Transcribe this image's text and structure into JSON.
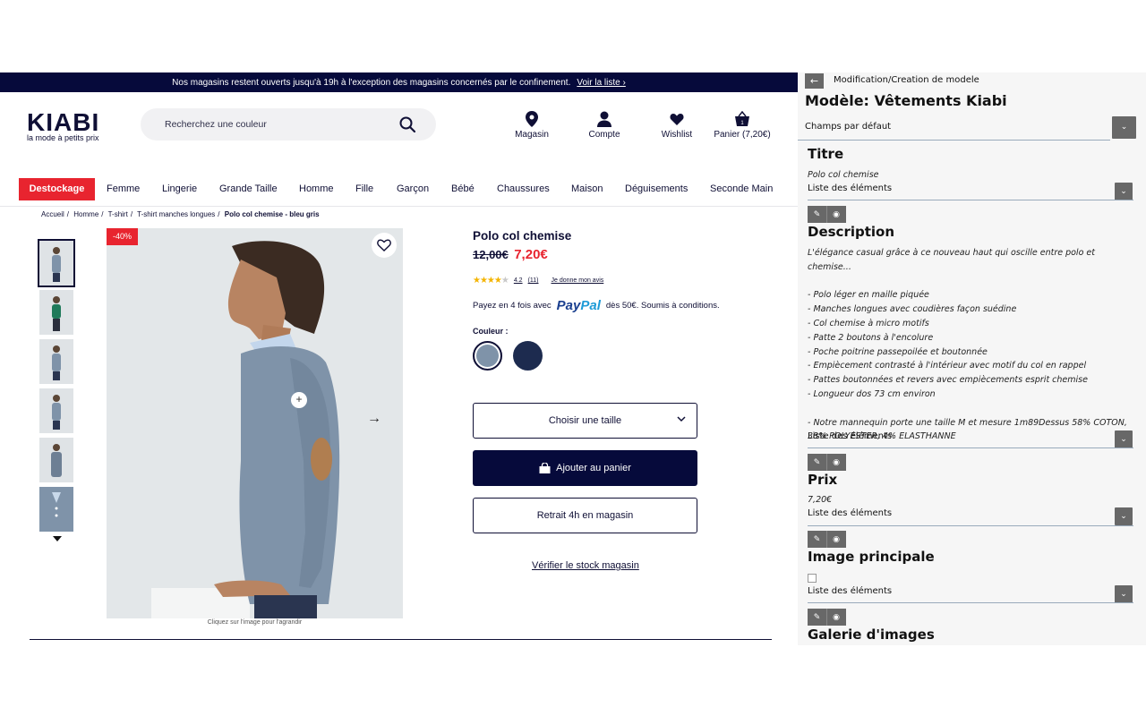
{
  "shop": {
    "promo_text": "Nos magasins restent ouverts jusqu'à 19h à l'exception des magasins concernés par le confinement.",
    "promo_link": "Voir la liste ›",
    "brand": "KIABI",
    "tagline": "la mode à petits prix",
    "search_placeholder": "Recherchez une couleur",
    "header": {
      "magasin": "Magasin",
      "compte": "Compte",
      "wishlist": "Wishlist",
      "panier": "Panier (7,20€)",
      "cart_count": "1"
    },
    "nav": [
      "Destockage",
      "Femme",
      "Lingerie",
      "Grande Taille",
      "Homme",
      "Fille",
      "Garçon",
      "Bébé",
      "Chaussures",
      "Maison",
      "Déguisements",
      "Seconde Main"
    ],
    "breadcrumb": [
      "Accueil",
      "Homme",
      "T-shirt",
      "T-shirt manches longues",
      "Polo col chemise - bleu gris"
    ],
    "discount_badge": "-40%",
    "image_caption": "Cliquez sur l'image pour l'agrandir",
    "product": {
      "title": "Polo col chemise",
      "old_price": "12,00€",
      "new_price": "7,20€",
      "rating": "4.2",
      "rating_value": 4.2,
      "reviews": "(11)",
      "review_link": "Je donne mon avis",
      "paypal_prefix": "Payez en 4 fois avec",
      "paypal_suffix": "dès 50€. Soumis à conditions.",
      "color_label": "Couleur :",
      "size_button": "Choisir une taille",
      "cart_button": "Ajouter au panier",
      "store_button": "Retrait 4h en magasin",
      "stock_link": "Vérifier le stock magasin"
    }
  },
  "panel": {
    "breadcrumb": "Modification/Creation de modele",
    "model_title": "Modèle: Vêtements Kiabi",
    "default_fields": "Champs par défaut",
    "list_label": "Liste des éléments",
    "sections": {
      "titre": {
        "title": "Titre",
        "value": "Polo col chemise"
      },
      "description": {
        "title": "Description",
        "lines": [
          "L'élégance casual grâce à ce nouveau haut qui oscille entre polo et chemise...",
          "",
          "- Polo léger en maille piquée",
          "- Manches longues avec coudières façon suédine",
          "- Col chemise à micro motifs",
          "- Patte 2 boutons à l'encolure",
          "- Poche poitrine passepoilée et boutonnée",
          "- Empiècement contrasté à l'intérieur avec motif du col en rappel",
          "- Pattes boutonnées et revers avec empiècements esprit chemise",
          "- Longueur dos 73 cm environ",
          "",
          "- Notre mannequin porte une taille M et mesure 1m89Dessus 58% COTON,",
          "38% POLYESTER, 4% ELASTHANNE"
        ]
      },
      "prix": {
        "title": "Prix",
        "value": "7,20€"
      },
      "image": {
        "title": "Image principale"
      },
      "galerie": {
        "title": "Galerie d'images"
      }
    }
  }
}
